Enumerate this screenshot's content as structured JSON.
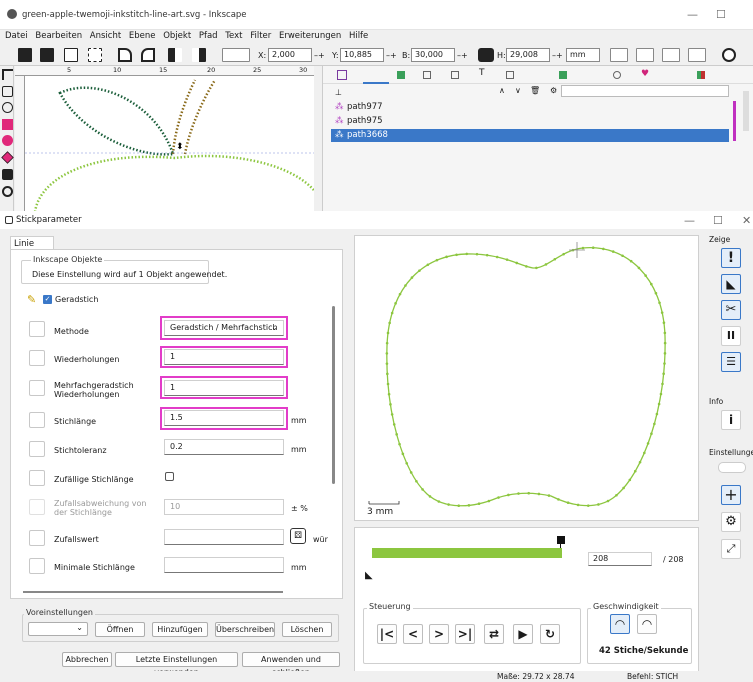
{
  "inkscape": {
    "title": "green-apple-twemoji-inkstitch-line-art.svg - Inkscape",
    "menu": [
      "Datei",
      "Bearbeiten",
      "Ansicht",
      "Ebene",
      "Objekt",
      "Pfad",
      "Text",
      "Filter",
      "Erweiterungen",
      "Hilfe"
    ],
    "toolbar": {
      "x_label": "X:",
      "x_value": "2,000",
      "y_label": "Y:",
      "y_value": "10,885",
      "w_label": "B:",
      "w_value": "30,000",
      "h_label": "H:",
      "h_value": "29,008",
      "unit": "mm"
    },
    "ruler_ticks": [
      "5",
      "10",
      "15",
      "20",
      "25",
      "30"
    ],
    "objects": [
      {
        "label": "path977",
        "selected": false
      },
      {
        "label": "path975",
        "selected": false
      },
      {
        "label": "path3668",
        "selected": true
      }
    ]
  },
  "dialog": {
    "title": "Stickparameter",
    "tab": "Linie",
    "group_label": "Inkscape Objekte",
    "group_text": "Diese Einstellung wird auf 1 Objekt angewendet.",
    "type_label": "Geradstich",
    "rows": [
      {
        "label": "Methode",
        "value": "Geradstich / Mehrfachstich",
        "unit": ""
      },
      {
        "label": "Wiederholungen",
        "value": "1",
        "unit": ""
      },
      {
        "label": "Mehrfachgeradstich Wiederholungen",
        "value": "1",
        "unit": ""
      },
      {
        "label": "Stichlänge",
        "value": "1.5",
        "unit": "mm"
      },
      {
        "label": "Stichtoleranz",
        "value": "0.2",
        "unit": "mm"
      },
      {
        "label": "Zufällige Stichlänge",
        "value": "",
        "unit": ""
      },
      {
        "label": "Zufallsabweichung von der Stichlänge",
        "value": "10",
        "unit": "± %"
      },
      {
        "label": "Zufallswert",
        "value": "",
        "unit": "wür"
      },
      {
        "label": "Minimale Stichlänge",
        "value": "",
        "unit": "mm"
      }
    ],
    "presets_label": "Voreinstellungen",
    "preset_buttons": [
      "Öffnen",
      "Hinzufügen",
      "Überschreiben",
      "Löschen"
    ],
    "bottom_buttons": [
      "Abbrechen",
      "Letzte Einstellungen verwenden",
      "Anwenden und schließen"
    ],
    "scale_label": "3 mm",
    "sim": {
      "current_stitch": "208",
      "total_stitches": "/ 208",
      "progress": 1.0,
      "control_label": "Steuerung",
      "speed_label": "Geschwindigkeit",
      "speed_value": "42 Stiche/Sekunde"
    },
    "side": {
      "show_label": "Zeige",
      "info_label": "Info",
      "settings_label": "Einstellungen"
    }
  },
  "status": {
    "size": "Maße: 29.72 x 28.74",
    "command": "Befehl: STICH"
  },
  "colors": {
    "accent": "#3a78c8",
    "highlight": "#e23cc8",
    "stitch": "#8cc63f",
    "leaf_line": "#1b5e3a",
    "stem_line": "#8a6a1a"
  }
}
